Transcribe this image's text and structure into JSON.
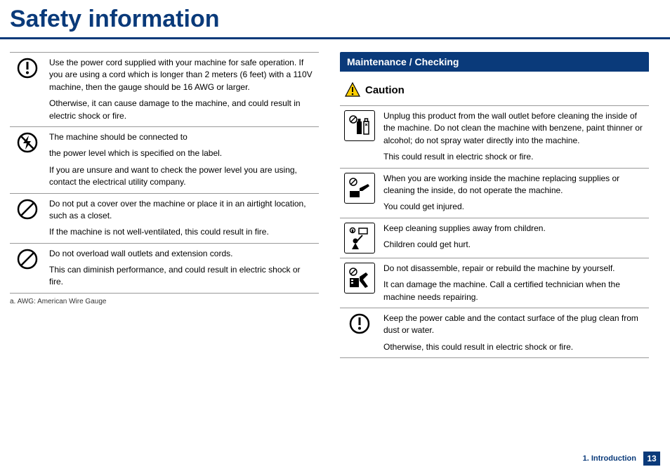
{
  "pageTitle": "Safety information",
  "left": {
    "rows": [
      {
        "icon": "exclaim-circle",
        "p1": "Use the power cord supplied with your machine for safe operation. If you are using a cord which is longer than 2 meters (6 feet) with a 110V machine, then the gauge should be 16 AWG or larger.",
        "p2": "Otherwise, it can cause damage to the machine, and could result in electric shock or fire."
      },
      {
        "icon": "bolt-no",
        "p1": "The machine should be connected to",
        "p2": "the power level which is specified on the label.",
        "p3": "If you are unsure and want to check the power level you are using, contact the electrical utility company."
      },
      {
        "icon": "no",
        "p1": "Do not put a cover over the machine or place it in an airtight location, such as a closet.",
        "p2": "If the machine is not well-ventilated, this could result in fire."
      },
      {
        "icon": "no",
        "p1": "Do not overload wall outlets and extension cords.",
        "p2": "This can diminish performance, and could result in electric shock or fire."
      }
    ],
    "footnote": "a.  AWG: American Wire Gauge"
  },
  "sectionHeader": "Maintenance / Checking",
  "cautionLabel": "Caution",
  "right": {
    "rows": [
      {
        "icon": "bottles",
        "p1": "Unplug this product from the wall outlet before cleaning the inside of the machine. Do not clean the machine with benzene, paint thinner or alcohol; do not spray water directly into the machine.",
        "p2": "This could result in electric shock or fire."
      },
      {
        "icon": "hand-no",
        "p1": "When you are working inside the machine replacing supplies or cleaning the inside, do not operate the machine.",
        "p2": "You could get injured."
      },
      {
        "icon": "child",
        "p1": "Keep cleaning supplies away from children.",
        "p2": "Children could get hurt."
      },
      {
        "icon": "tool-no",
        "p1": "Do not disassemble, repair or rebuild the machine by yourself.",
        "p2": "It can damage the machine. Call a certified technician when the machine needs repairing."
      },
      {
        "icon": "exclaim-circle",
        "p1": "Keep the power cable and the contact surface of the plug clean from dust or water.",
        "p2": "Otherwise, this could result in electric shock or fire."
      }
    ]
  },
  "footer": {
    "chapter": "1. Introduction",
    "page": "13"
  }
}
